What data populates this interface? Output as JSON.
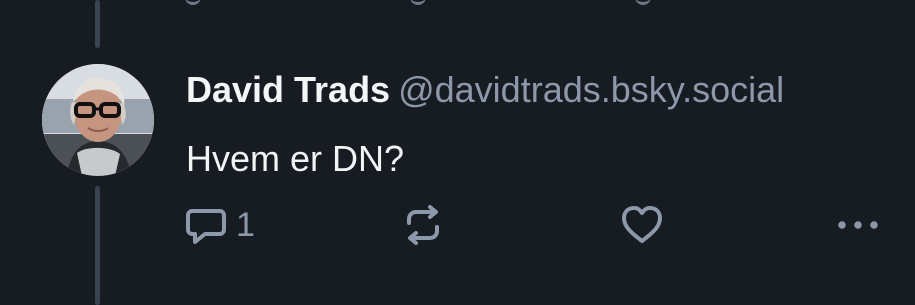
{
  "post": {
    "author": {
      "name": "David Trads",
      "handle": "@davidtrads.bsky.social",
      "avatar_icon": "avatar-photo"
    },
    "text": "Hvem er DN?",
    "actions": {
      "reply_icon": "reply-icon",
      "reply_count": "1",
      "repost_icon": "repost-icon",
      "like_icon": "heart-icon",
      "more_icon": "more-icon"
    }
  },
  "colors": {
    "background": "#171b22",
    "thread_line": "#3a4350",
    "primary_text": "#f1f3f5",
    "secondary_text": "#8d99aa"
  }
}
